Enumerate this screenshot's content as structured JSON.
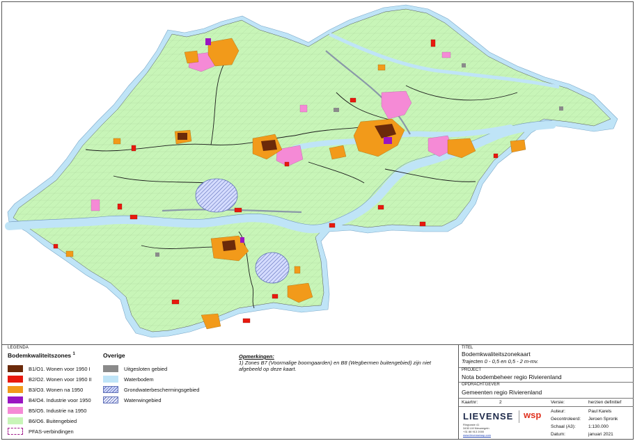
{
  "legend": {
    "header": "LEGENDA",
    "zones_title": "Bodemkwaliteitszones",
    "zones_title_note": "1",
    "zones": [
      {
        "label": "B1/O1. Wonen voor 1950 I",
        "color": "#6b2a0a"
      },
      {
        "label": "B2/O2. Wonen voor 1950 II",
        "color": "#e8190e"
      },
      {
        "label": "B3/O3. Wonen na 1950",
        "color": "#f29a1a"
      },
      {
        "label": "B4/O4. Industrie voor 1950",
        "color": "#9a15c2"
      },
      {
        "label": "B5/O5. Industrie na 1950",
        "color": "#f58ad6"
      },
      {
        "label": "B6/O6. Buitengebied",
        "color": "#c8f5b8"
      }
    ],
    "pfas_label": "PFAS-verbindingen",
    "others_title": "Overige",
    "others": [
      {
        "label": "Uitgesloten gebied",
        "color": "#8a8a8a"
      },
      {
        "label": "Waterbodem",
        "color": "#bfe4f7"
      },
      {
        "label": "Grondwaterbeschermingsgebied",
        "style": "hatch"
      },
      {
        "label": "Waterwingebied",
        "style": "hatch2"
      }
    ]
  },
  "remarks": {
    "title": "Opmerkingen:",
    "text": "1) Zones B7 (Voormalige boomgaarden) en B8 (Wegbermen buitengebied) zijn niet afgebeeld op deze kaart."
  },
  "titleblock": {
    "titel_label": "TITEL",
    "title": "Bodemkwaliteitszonekaart",
    "subtitle": "Trajecten 0 - 0,5 en 0,5 - 2 m-mv.",
    "project_label": "PROJECT",
    "project": "Nota bodembeheer regio Rivierenland",
    "client_label": "OPDRACHTGEVER",
    "client": "Gemeenten regio Rivierenland",
    "kaartnr_label": "Kaartnr:",
    "kaartnr": "2",
    "versie_label": "Versie:",
    "versie": "herzien definitief",
    "auteur_label": "Auteur:",
    "auteur": "Paul Karels",
    "gecontroleerd_label": "Gecontroleerd:",
    "gecontroleerd": "Jeroen Spronk",
    "schaal_label": "Schaal (A3):",
    "schaal": "1:130.000",
    "datum_label": "Datum:",
    "datum": "januari 2021",
    "logo_left": "LIEVENSE",
    "logo_right": "wsp",
    "address_1": "Ringvaste 41",
    "address_2": "3430 LM Nieuwegein",
    "address_3": "+31 88 913 2000",
    "address_4": "www.lievensewsp.com"
  },
  "map": {
    "land_color": "#c8f5b8",
    "water_color": "#bfe4f7",
    "river_color": "#bfe4f7",
    "boundary_color": "#1a1a1a"
  }
}
